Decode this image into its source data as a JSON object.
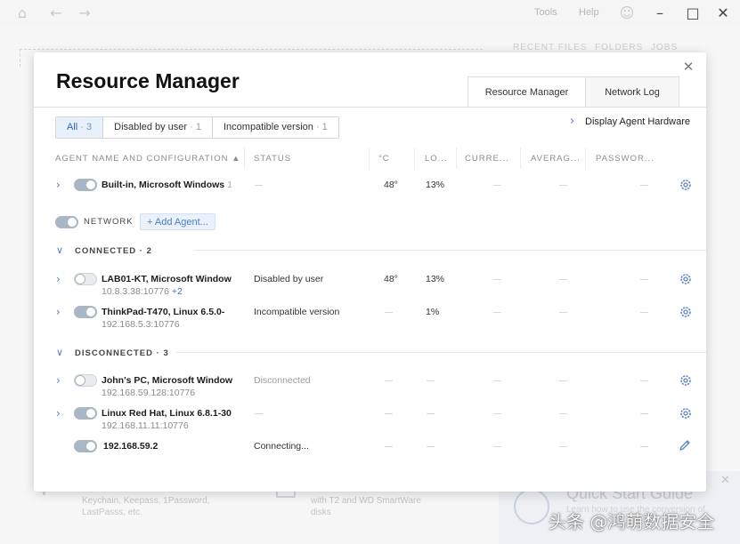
{
  "titlebar": {
    "menu_tools": "Tools",
    "menu_help": "Help",
    "icons": [
      "home-icon",
      "back-icon",
      "forward-icon",
      "smiley-icon",
      "minimize-icon",
      "maximize-icon",
      "close-icon"
    ]
  },
  "background": {
    "tab_recent": "RECENT FILES",
    "tab_folders": "FOLDERS",
    "tab_jobs": "JOBS",
    "card1_text_line1": "Keychain, Keepass, 1Password,",
    "card1_text_line2": "LastPasss, etc.",
    "card2_text_line1": "with T2 and WD SmartWare",
    "card2_text_line2": "disks",
    "quick_start_title": "Quick Start Guide",
    "quick_start_sub": "Learn how to use the conversion of",
    "watermark": "头条 @鸿萌数据安全"
  },
  "modal": {
    "title": "Resource Manager",
    "tabs": [
      {
        "label": "Resource Manager",
        "active": true
      },
      {
        "label": "Network Log",
        "active": false
      }
    ],
    "filters": [
      {
        "label": "All",
        "count": "· 3",
        "active": true
      },
      {
        "label": "Disabled by user",
        "count": "· 1",
        "active": false
      },
      {
        "label": "Incompatible version",
        "count": "· 1",
        "active": false
      }
    ],
    "hardware_link": "Display Agent Hardware",
    "columns": [
      "AGENT NAME AND CONFIGURATION ▲",
      "STATUS",
      "°C",
      "LO...",
      "CURRE...",
      "AVERAG...",
      "PASSWOR..."
    ],
    "builtin": {
      "name": "Built-in, Microsoft Windows",
      "version": "1",
      "status": "",
      "temp": "48°",
      "load": "13%"
    },
    "network_label": "NETWORK",
    "add_agent": "+ Add Agent...",
    "connected_title": "CONNECTED · 2",
    "connected": [
      {
        "name": "LAB01-KT, Microsoft Window",
        "addr": "10.8.3.38:10776",
        "more": "+2",
        "status": "Disabled by user",
        "temp": "48°",
        "load": "13%"
      },
      {
        "name": "ThinkPad-T470, Linux 6.5.0-",
        "addr": "192.168.5.3:10776",
        "status": "Incompatible version",
        "temp": "",
        "load": "1%"
      }
    ],
    "disconnected_title": "DISCONNECTED · 3",
    "disconnected": [
      {
        "name": "John's PC, Microsoft Window",
        "addr": "192.168.59.128:10776",
        "status": "Disconnected"
      },
      {
        "name": "Linux Red Hat, Linux 6.8.1-30",
        "addr": "192.168.11.11:10776",
        "status": ""
      },
      {
        "name": "192.168.59.2",
        "addr": "",
        "status": "Connecting..."
      }
    ]
  },
  "colors": {
    "accent": "#3d73c0",
    "active_filter_bg": "#e7f0fb"
  }
}
